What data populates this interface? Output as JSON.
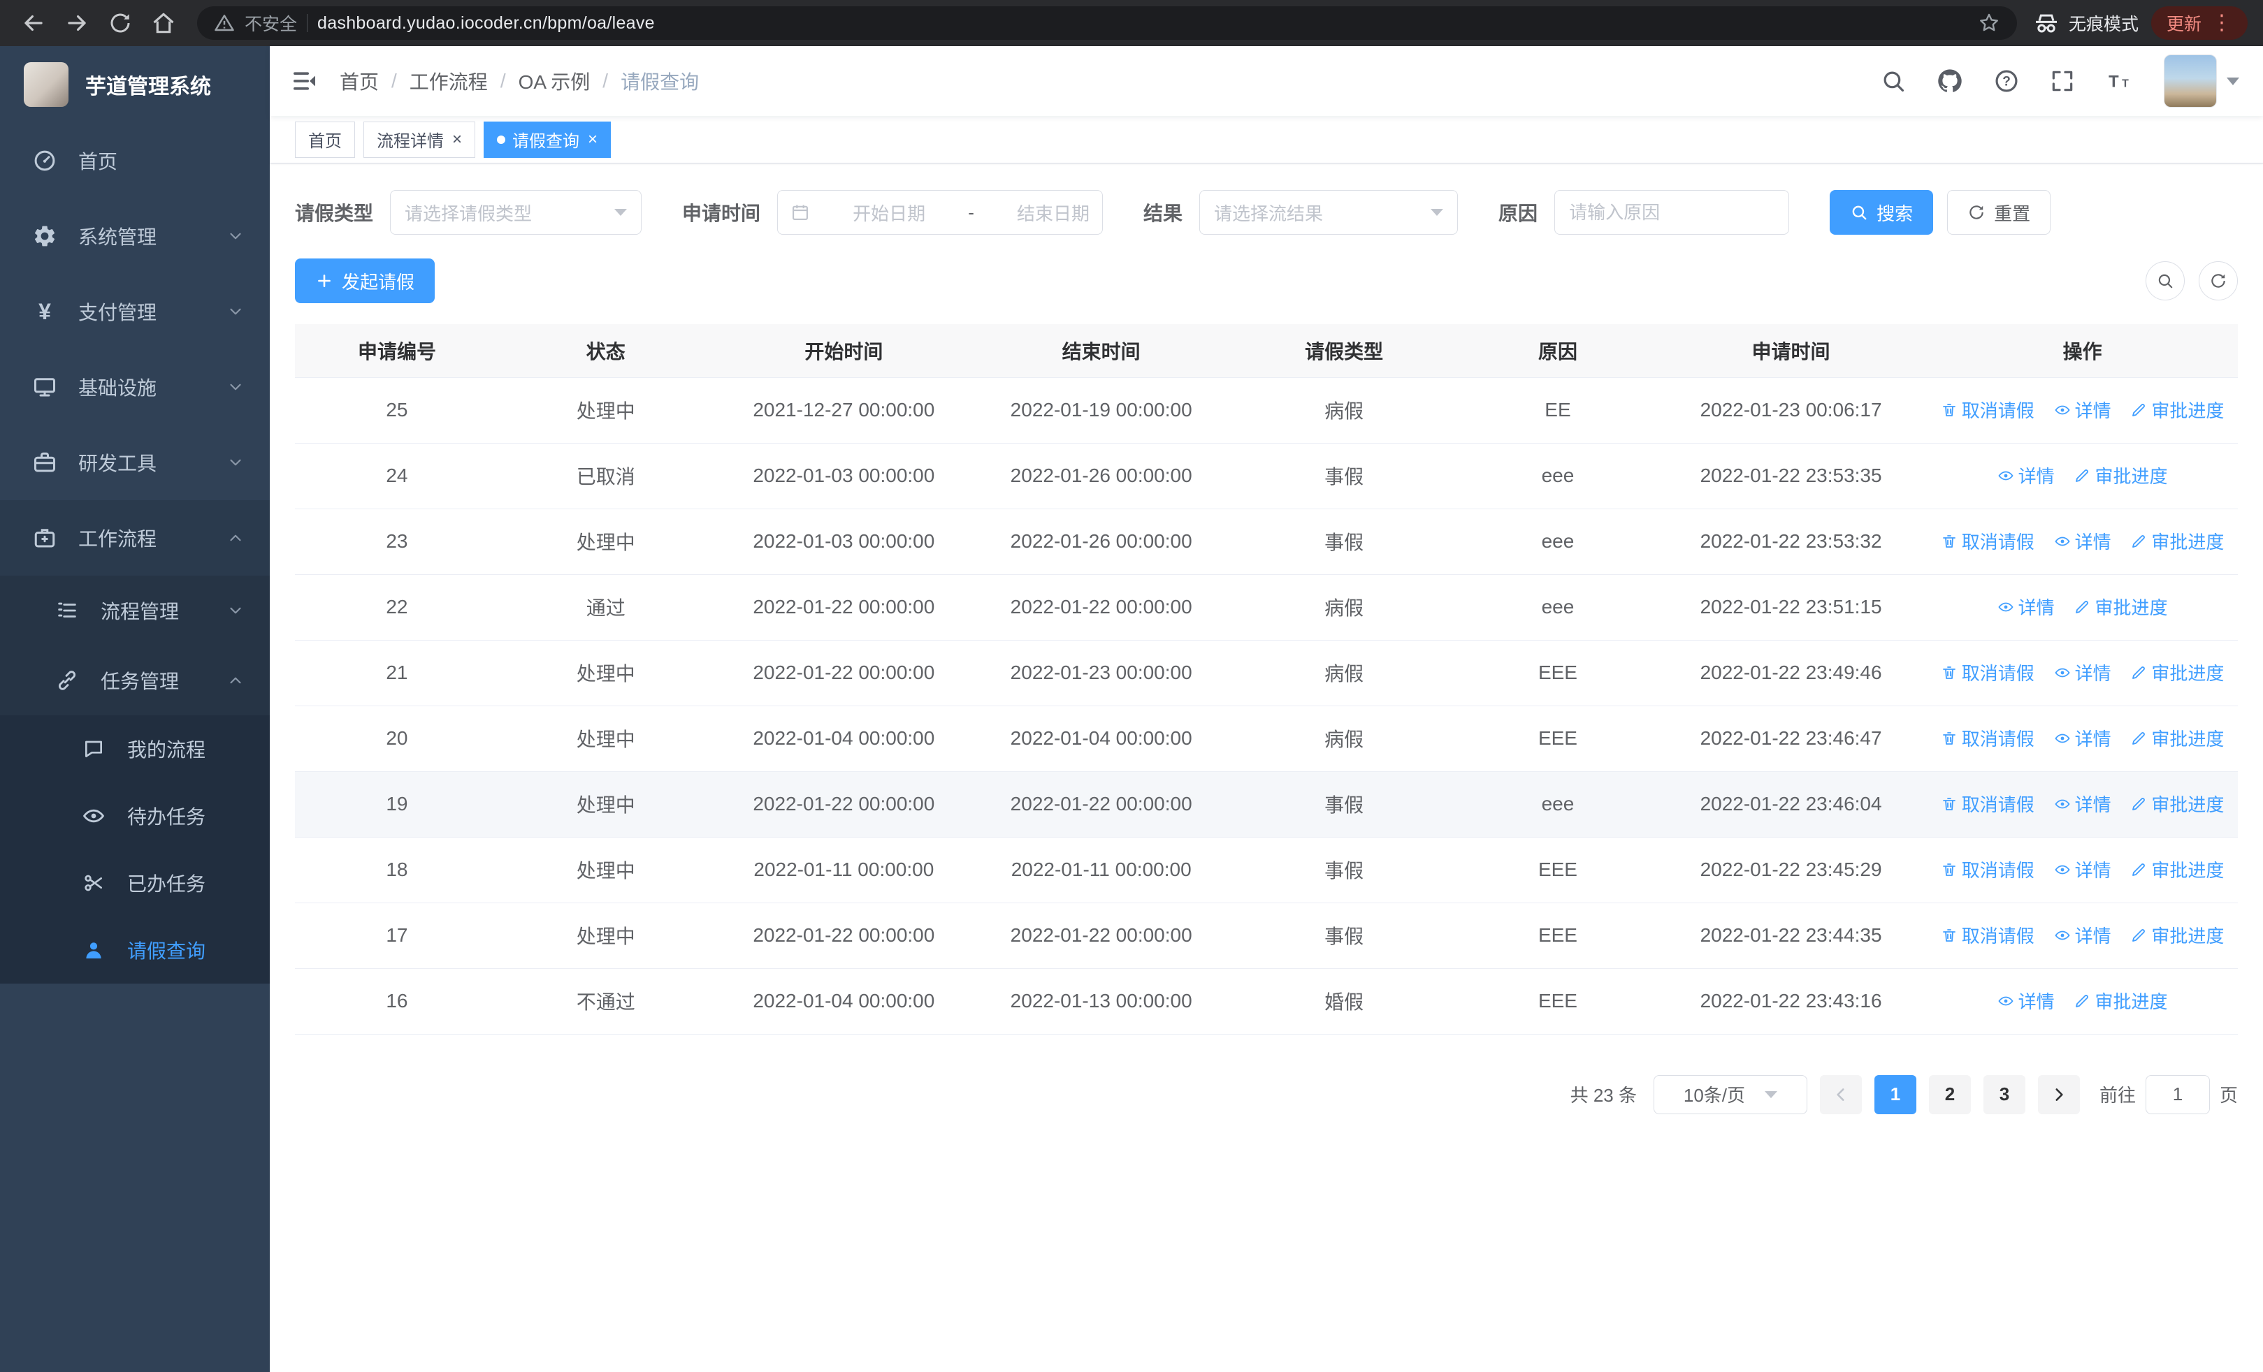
{
  "colors": {
    "primary": "#409eff",
    "sidebar_bg": "#304156",
    "chrome_bg": "#2a2b2e"
  },
  "browser": {
    "security_warning": "不安全",
    "url": "dashboard.yudao.iocoder.cn/bpm/oa/leave",
    "incognito_label": "无痕模式",
    "update_label": "更新"
  },
  "sidebar": {
    "logo_title": "芋道管理系统",
    "items": [
      {
        "label": "首页"
      },
      {
        "label": "系统管理"
      },
      {
        "label": "支付管理"
      },
      {
        "label": "基础设施"
      },
      {
        "label": "研发工具"
      },
      {
        "label": "工作流程"
      }
    ],
    "workflow_children": [
      {
        "label": "流程管理"
      },
      {
        "label": "任务管理"
      }
    ],
    "task_children": [
      {
        "label": "我的流程"
      },
      {
        "label": "待办任务"
      },
      {
        "label": "已办任务"
      },
      {
        "label": "请假查询"
      }
    ]
  },
  "header": {
    "breadcrumb": [
      "首页",
      "工作流程",
      "OA 示例",
      "请假查询"
    ]
  },
  "tabs": [
    {
      "label": "首页"
    },
    {
      "label": "流程详情"
    },
    {
      "label": "请假查询"
    }
  ],
  "filters": {
    "leave_type_label": "请假类型",
    "leave_type_placeholder": "请选择请假类型",
    "apply_time_label": "申请时间",
    "start_date_placeholder": "开始日期",
    "range_separator": "-",
    "end_date_placeholder": "结束日期",
    "result_label": "结果",
    "result_placeholder": "请选择流结果",
    "reason_label": "原因",
    "reason_placeholder": "请输入原因",
    "search_button": "搜索",
    "reset_button": "重置"
  },
  "toolbar": {
    "create_button": "发起请假"
  },
  "table": {
    "columns": [
      "申请编号",
      "状态",
      "开始时间",
      "结束时间",
      "请假类型",
      "原因",
      "申请时间",
      "操作"
    ],
    "actions": {
      "cancel": "取消请假",
      "detail": "详情",
      "progress": "审批进度"
    },
    "rows": [
      {
        "id": "25",
        "status": "处理中",
        "start": "2021-12-27 00:00:00",
        "end": "2022-01-19 00:00:00",
        "type": "病假",
        "reason": "EE",
        "apply_time": "2022-01-23 00:06:17",
        "cancellable": true
      },
      {
        "id": "24",
        "status": "已取消",
        "start": "2022-01-03 00:00:00",
        "end": "2022-01-26 00:00:00",
        "type": "事假",
        "reason": "eee",
        "apply_time": "2022-01-22 23:53:35",
        "cancellable": false
      },
      {
        "id": "23",
        "status": "处理中",
        "start": "2022-01-03 00:00:00",
        "end": "2022-01-26 00:00:00",
        "type": "事假",
        "reason": "eee",
        "apply_time": "2022-01-22 23:53:32",
        "cancellable": true
      },
      {
        "id": "22",
        "status": "通过",
        "start": "2022-01-22 00:00:00",
        "end": "2022-01-22 00:00:00",
        "type": "病假",
        "reason": "eee",
        "apply_time": "2022-01-22 23:51:15",
        "cancellable": false
      },
      {
        "id": "21",
        "status": "处理中",
        "start": "2022-01-22 00:00:00",
        "end": "2022-01-23 00:00:00",
        "type": "病假",
        "reason": "EEE",
        "apply_time": "2022-01-22 23:49:46",
        "cancellable": true
      },
      {
        "id": "20",
        "status": "处理中",
        "start": "2022-01-04 00:00:00",
        "end": "2022-01-04 00:00:00",
        "type": "病假",
        "reason": "EEE",
        "apply_time": "2022-01-22 23:46:47",
        "cancellable": true
      },
      {
        "id": "19",
        "status": "处理中",
        "start": "2022-01-22 00:00:00",
        "end": "2022-01-22 00:00:00",
        "type": "事假",
        "reason": "eee",
        "apply_time": "2022-01-22 23:46:04",
        "cancellable": true,
        "highlight": true
      },
      {
        "id": "18",
        "status": "处理中",
        "start": "2022-01-11 00:00:00",
        "end": "2022-01-11 00:00:00",
        "type": "事假",
        "reason": "EEE",
        "apply_time": "2022-01-22 23:45:29",
        "cancellable": true
      },
      {
        "id": "17",
        "status": "处理中",
        "start": "2022-01-22 00:00:00",
        "end": "2022-01-22 00:00:00",
        "type": "事假",
        "reason": "EEE",
        "apply_time": "2022-01-22 23:44:35",
        "cancellable": true
      },
      {
        "id": "16",
        "status": "不通过",
        "start": "2022-01-04 00:00:00",
        "end": "2022-01-13 00:00:00",
        "type": "婚假",
        "reason": "EEE",
        "apply_time": "2022-01-22 23:43:16",
        "cancellable": false
      }
    ]
  },
  "pagination": {
    "total_text": "共 23 条",
    "page_size": "10条/页",
    "pages": [
      "1",
      "2",
      "3"
    ],
    "active_page": "1",
    "goto_label": "前往",
    "goto_value": "1",
    "page_label": "页"
  }
}
